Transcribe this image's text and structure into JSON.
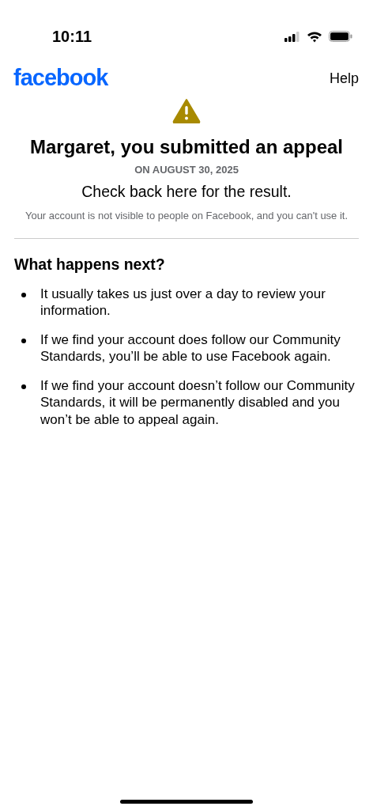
{
  "status_bar": {
    "time": "10:11"
  },
  "header": {
    "logo": "facebook",
    "help": "Help"
  },
  "notice": {
    "title": "Margaret, you submitted an appeal",
    "date": "ON AUGUST 30, 2025",
    "subtitle": "Check back here for the result.",
    "note": "Your account is not visible to people on Facebook, and you can't use it."
  },
  "next_steps": {
    "heading": "What happens next?",
    "items": [
      "It usually takes us just over a day to review your information.",
      "If we find your account does follow our Community Standards, you’ll be able to use Facebook again.",
      "If we find your account doesn’t follow our Community Standards, it will be permanently disabled and you won’t be able to appeal again."
    ]
  }
}
